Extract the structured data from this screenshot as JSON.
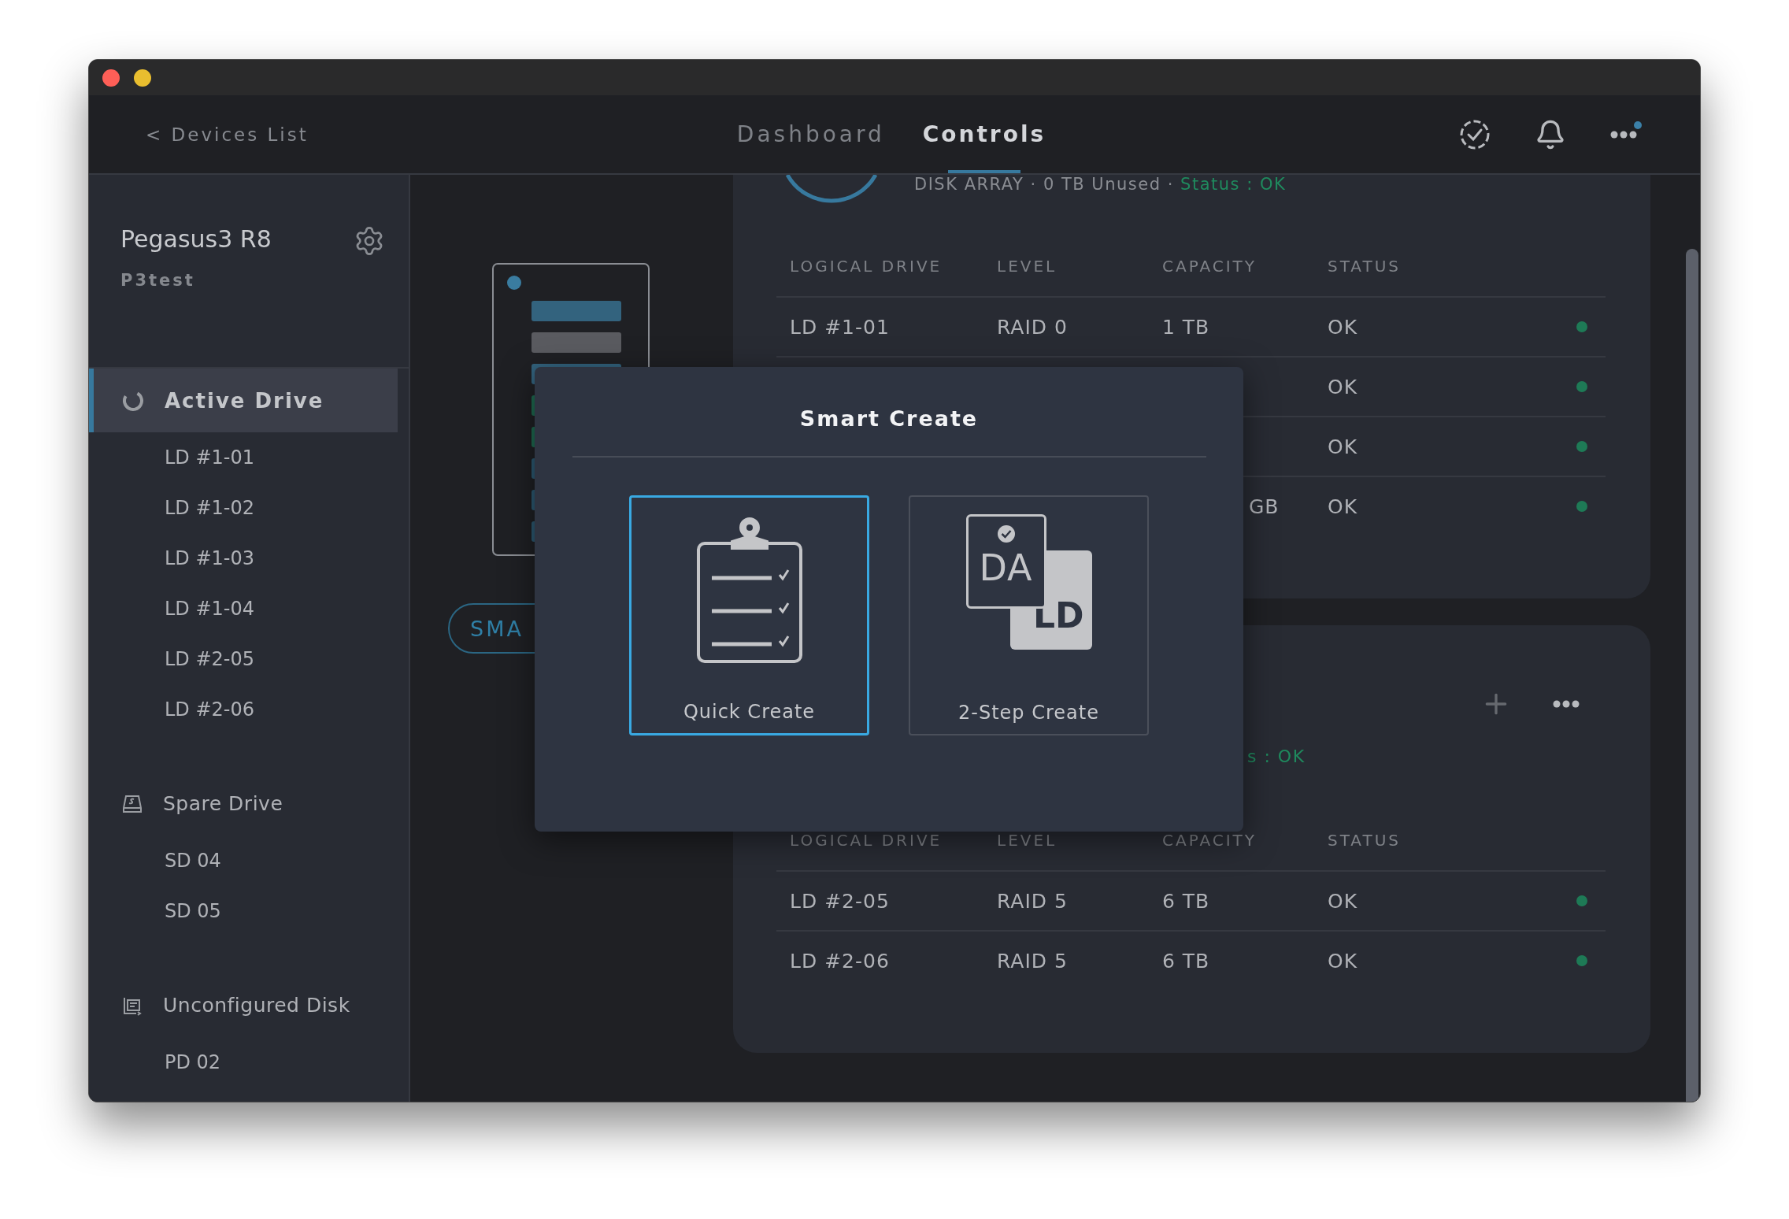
{
  "header": {
    "back": "< Devices List",
    "tabs": [
      {
        "label": "Dashboard",
        "selected": false
      },
      {
        "label": "Controls",
        "selected": true
      }
    ],
    "more_badge": true
  },
  "sidebar": {
    "device_name": "Pegasus3 R8",
    "device_id": "P3test",
    "sections": [
      {
        "label": "Active Drive",
        "kind": "active",
        "selected": true,
        "children": [
          {
            "label": "LD #1-01"
          },
          {
            "label": "LD #1-02"
          },
          {
            "label": "LD #1-03"
          },
          {
            "label": "LD #1-04"
          },
          {
            "label": "LD #2-05"
          },
          {
            "label": "LD #2-06"
          }
        ]
      },
      {
        "label": "Spare Drive",
        "kind": "spare",
        "selected": false,
        "children": [
          {
            "label": "SD 04"
          },
          {
            "label": "SD 05"
          }
        ]
      },
      {
        "label": "Unconfigured Disk",
        "kind": "unconfigured",
        "selected": false,
        "children": [
          {
            "label": "PD 02"
          }
        ]
      }
    ]
  },
  "device_panel": {
    "button": "SMA"
  },
  "arrays": [
    {
      "summary": "DISK ARRAY · 0 TB Unused · ",
      "status": "Status : OK",
      "columns": [
        "LOGICAL DRIVE",
        "LEVEL",
        "CAPACITY",
        "STATUS"
      ],
      "rows": [
        {
          "logical_drive": "LD #1-01",
          "level": "RAID 0",
          "capacity": "1 TB",
          "status": "OK",
          "color": "#1e7a56"
        },
        {
          "status": "OK",
          "color": "#1e7a56"
        },
        {
          "status": "OK",
          "color": "#1e7a56"
        },
        {
          "capacity": "GB",
          "status": "OK",
          "color": "#1e7a56"
        }
      ]
    },
    {
      "status": "s : OK",
      "columns": [
        "LOGICAL DRIVE",
        "LEVEL",
        "CAPACITY",
        "STATUS"
      ],
      "rows": [
        {
          "logical_drive": "LD #2-05",
          "level": "RAID 5",
          "capacity": "6 TB",
          "status": "OK",
          "color": "#1e7a56"
        },
        {
          "logical_drive": "LD #2-06",
          "level": "RAID 5",
          "capacity": "6 TB",
          "status": "OK",
          "color": "#1e7a56"
        }
      ]
    }
  ],
  "dialog": {
    "title": "Smart Create",
    "options": [
      {
        "label": "Quick Create",
        "kind": "checklist",
        "selected": true
      },
      {
        "label": "2-Step Create",
        "kind": "arrays",
        "selected": false,
        "badges": [
          "DA",
          "LD"
        ]
      }
    ]
  }
}
